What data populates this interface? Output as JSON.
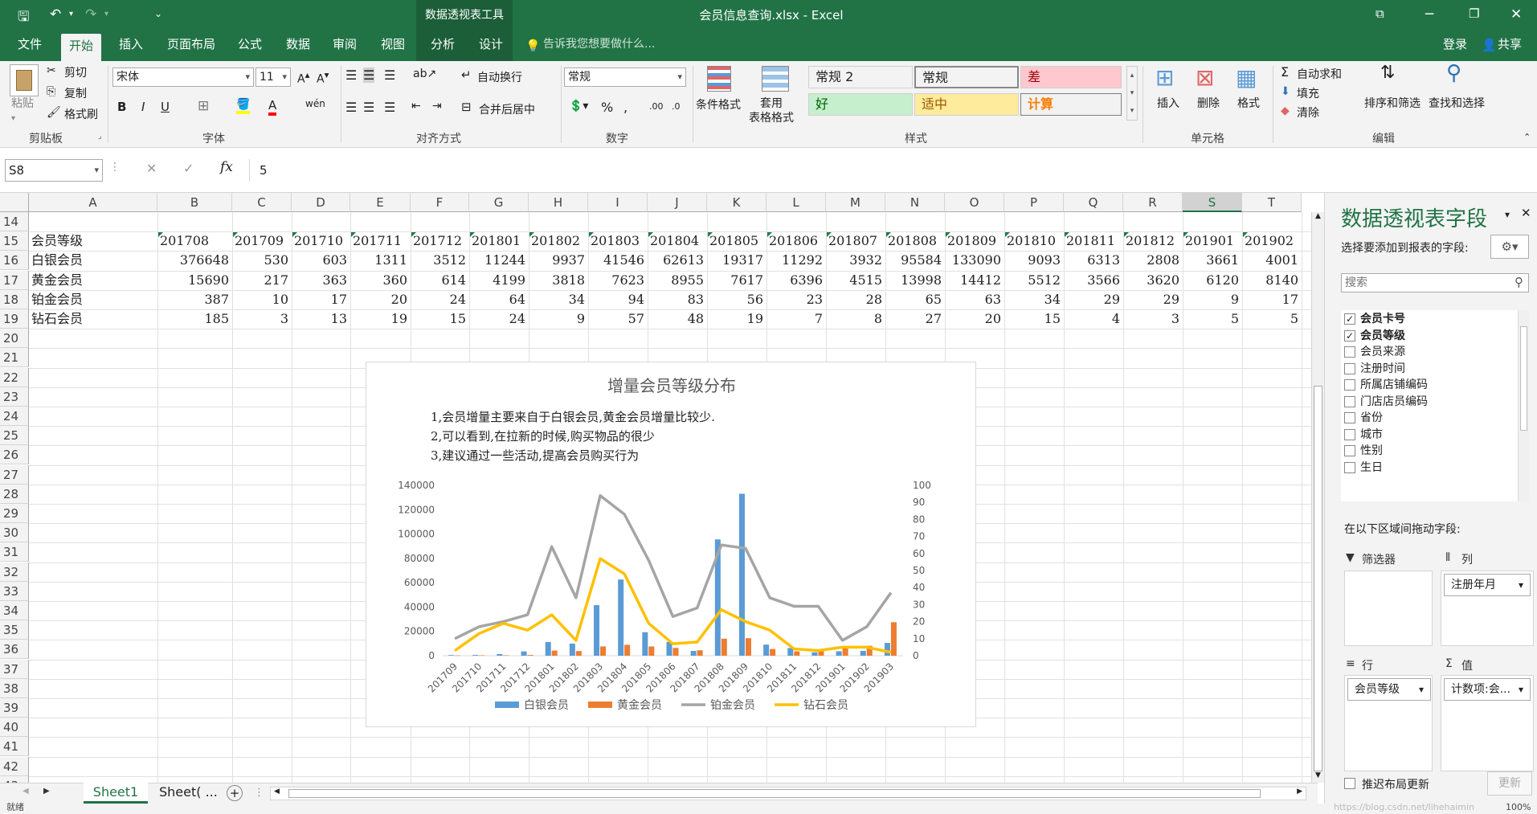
{
  "window": {
    "title": "会员信息查询.xlsx - Excel",
    "context_tab_group": "数据透视表工具",
    "login": "登录",
    "share": "共享"
  },
  "tabs": [
    "文件",
    "开始",
    "插入",
    "页面布局",
    "公式",
    "数据",
    "审阅",
    "视图",
    "分析",
    "设计"
  ],
  "tell_me": "告诉我您想要做什么...",
  "ribbon": {
    "clipboard": {
      "label": "剪贴板",
      "paste": "粘贴",
      "cut": "剪切",
      "copy": "复制",
      "format_painter": "格式刷"
    },
    "font": {
      "label": "字体",
      "name": "宋体",
      "size": "11"
    },
    "alignment": {
      "label": "对齐方式",
      "wrap": "自动换行",
      "merge": "合并后居中"
    },
    "number": {
      "label": "数字",
      "format": "常规"
    },
    "styles": {
      "label": "样式",
      "conditional": "条件格式",
      "table_format": "套用\n表格格式",
      "cells": [
        {
          "text": "常规 2",
          "bg": "#ffffff",
          "fg": "#222222"
        },
        {
          "text": "常规",
          "bg": "#ffffff",
          "fg": "#222222"
        },
        {
          "text": "差",
          "bg": "#ffc7ce",
          "fg": "#9c0006"
        },
        {
          "text": "好",
          "bg": "#c6efce",
          "fg": "#006100"
        },
        {
          "text": "适中",
          "bg": "#ffeb9c",
          "fg": "#9c5700"
        },
        {
          "text": "计算",
          "bg": "#f2f2f2",
          "fg": "#fa7d00"
        }
      ]
    },
    "cells": {
      "label": "单元格",
      "insert": "插入",
      "delete": "删除",
      "format": "格式"
    },
    "editing": {
      "label": "编辑",
      "autosum": "自动求和",
      "fill": "填充",
      "clear": "清除",
      "sort": "排序和筛选",
      "find": "查找和选择"
    }
  },
  "formula_bar": {
    "name_box": "S8",
    "formula": "5"
  },
  "columns": [
    "A",
    "B",
    "C",
    "D",
    "E",
    "F",
    "G",
    "H",
    "I",
    "J",
    "K",
    "L",
    "M",
    "N",
    "O",
    "P",
    "Q",
    "R",
    "S",
    "T"
  ],
  "rows": [
    "14",
    "15",
    "16",
    "17",
    "18",
    "19",
    "20",
    "21",
    "22",
    "23",
    "24",
    "25",
    "26",
    "27",
    "28",
    "29",
    "30",
    "31",
    "32",
    "33",
    "34",
    "35",
    "36",
    "37",
    "38",
    "39",
    "40",
    "41",
    "42",
    "43"
  ],
  "table": {
    "header_label": "会员等级",
    "months": [
      "201708",
      "201709",
      "201710",
      "201711",
      "201712",
      "201801",
      "201802",
      "201803",
      "201804",
      "201805",
      "201806",
      "201807",
      "201808",
      "201809",
      "201810",
      "201811",
      "201812",
      "201901",
      "201902"
    ],
    "data": [
      {
        "name": "白银会员",
        "values": [
          "376648",
          "530",
          "603",
          "1311",
          "3512",
          "11244",
          "9937",
          "41546",
          "62613",
          "19317",
          "11292",
          "3932",
          "95584",
          "133090",
          "9093",
          "6313",
          "2808",
          "3661",
          "4001"
        ]
      },
      {
        "name": "黄金会员",
        "values": [
          "15690",
          "217",
          "363",
          "360",
          "614",
          "4199",
          "3818",
          "7623",
          "8955",
          "7617",
          "6396",
          "4515",
          "13998",
          "14412",
          "5512",
          "3566",
          "3620",
          "6120",
          "8140"
        ]
      },
      {
        "name": "铂金会员",
        "values": [
          "387",
          "10",
          "17",
          "20",
          "24",
          "64",
          "34",
          "94",
          "83",
          "56",
          "23",
          "28",
          "65",
          "63",
          "34",
          "29",
          "29",
          "9",
          "17"
        ]
      },
      {
        "name": "钻石会员",
        "values": [
          "185",
          "3",
          "13",
          "19",
          "15",
          "24",
          "9",
          "57",
          "48",
          "19",
          "7",
          "8",
          "27",
          "20",
          "15",
          "4",
          "3",
          "5",
          "5"
        ]
      }
    ]
  },
  "chart_data": {
    "type": "bar",
    "title": "增量会员等级分布",
    "annotations": [
      "1,会员增量主要来自于白银会员,黄金会员增量比较少.",
      "2,可以看到,在拉新的时候,购买物品的很少",
      "3,建议通过一些活动,提高会员购买行为"
    ],
    "categories": [
      "201709",
      "201710",
      "201711",
      "201712",
      "201801",
      "201802",
      "201803",
      "201804",
      "201805",
      "201806",
      "201807",
      "201808",
      "201809",
      "201810",
      "201811",
      "201812",
      "201901",
      "201902",
      "201903"
    ],
    "y_ticks": [
      "0",
      "20000",
      "40000",
      "60000",
      "80000",
      "100000",
      "120000",
      "140000"
    ],
    "y2_ticks": [
      "0",
      "10",
      "20",
      "30",
      "40",
      "50",
      "60",
      "70",
      "80",
      "90",
      "100"
    ],
    "ylim": [
      0,
      140000
    ],
    "y2lim": [
      0,
      100
    ],
    "series": [
      {
        "name": "白银会员",
        "kind": "bar",
        "axis": "left",
        "color": "#5b9bd5",
        "values": [
          530,
          603,
          1311,
          3512,
          11244,
          9937,
          41546,
          62613,
          19317,
          11292,
          3932,
          95584,
          133090,
          9093,
          6313,
          2808,
          3661,
          4001,
          10500
        ]
      },
      {
        "name": "黄金会员",
        "kind": "bar",
        "axis": "left",
        "color": "#ed7d31",
        "values": [
          217,
          363,
          360,
          614,
          4199,
          3818,
          7623,
          8955,
          7617,
          6396,
          4515,
          13998,
          14412,
          5512,
          3566,
          3620,
          6120,
          8140,
          27500
        ]
      },
      {
        "name": "铂金会员",
        "kind": "line",
        "axis": "right",
        "color": "#a5a5a5",
        "values": [
          10,
          17,
          20,
          24,
          64,
          34,
          94,
          83,
          56,
          23,
          28,
          65,
          63,
          34,
          29,
          29,
          9,
          17,
          37
        ]
      },
      {
        "name": "钻石会员",
        "kind": "line",
        "axis": "right",
        "color": "#ffc000",
        "values": [
          3,
          13,
          19,
          15,
          24,
          9,
          57,
          48,
          19,
          7,
          8,
          27,
          20,
          15,
          4,
          3,
          5,
          5,
          2
        ]
      }
    ],
    "legend": "bottom"
  },
  "sheets": [
    "Sheet1",
    "Sheet( ..."
  ],
  "status": {
    "ready": "就绪",
    "zoom": "100%",
    "watermark": "https://blog.csdn.net/lihehaimin"
  },
  "pivot_pane": {
    "title": "数据透视表字段",
    "subtitle": "选择要添加到报表的字段:",
    "search_placeholder": "搜索",
    "fields": [
      {
        "name": "会员卡号",
        "checked": true
      },
      {
        "name": "会员等级",
        "checked": true
      },
      {
        "name": "会员来源",
        "checked": false
      },
      {
        "name": "注册时间",
        "checked": false
      },
      {
        "name": "所属店铺编码",
        "checked": false
      },
      {
        "name": "门店店员编码",
        "checked": false
      },
      {
        "name": "省份",
        "checked": false
      },
      {
        "name": "城市",
        "checked": false
      },
      {
        "name": "性别",
        "checked": false
      },
      {
        "name": "生日",
        "checked": false
      }
    ],
    "drag_label": "在以下区域间拖动字段:",
    "filter": "筛选器",
    "columns": "列",
    "rows": "行",
    "values": "值",
    "column_field": "注册年月",
    "row_field": "会员等级",
    "value_field": "计数项:会...",
    "defer": "推迟布局更新",
    "update": "更新"
  }
}
